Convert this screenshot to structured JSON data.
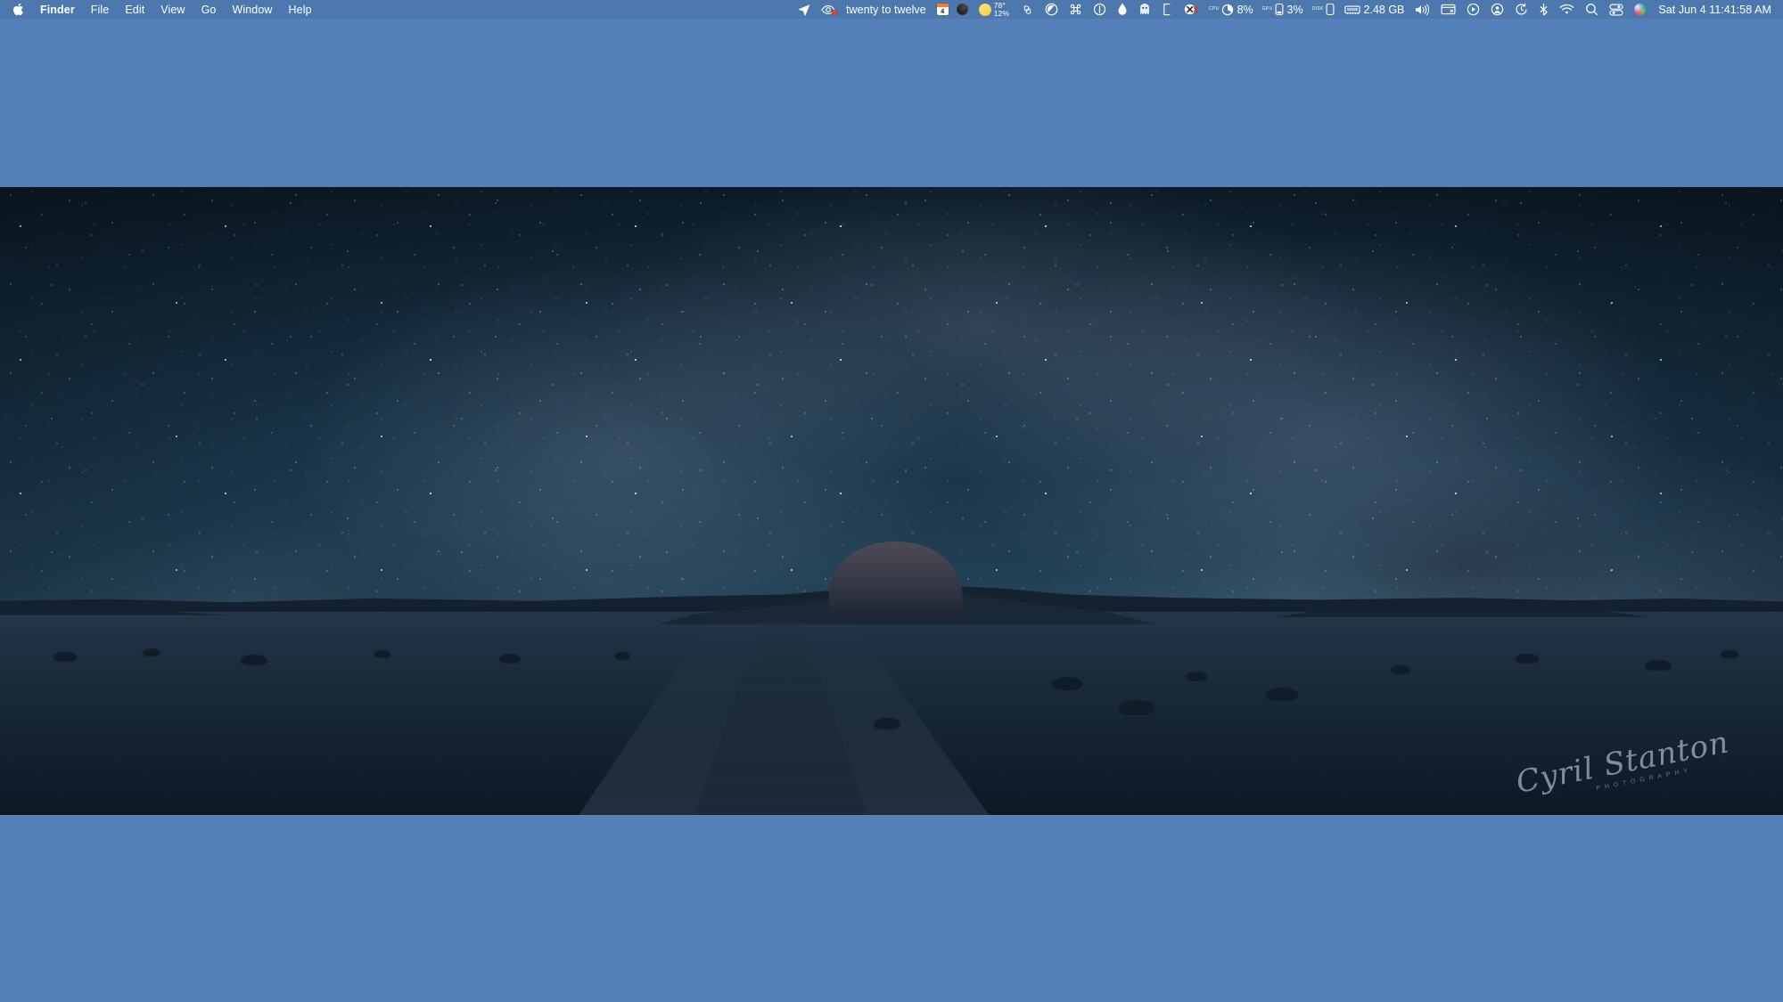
{
  "menubar": {
    "apple_icon": "apple-logo-icon",
    "app_menus": [
      {
        "label": "Finder",
        "bold": true
      },
      {
        "label": "File",
        "bold": false
      },
      {
        "label": "Edit",
        "bold": false
      },
      {
        "label": "View",
        "bold": false
      },
      {
        "label": "Go",
        "bold": false
      },
      {
        "label": "Window",
        "bold": false
      },
      {
        "label": "Help",
        "bold": false
      }
    ],
    "status": {
      "location_icon": "location-arrow-icon",
      "eye_globe_icon": "eye-globe-icon",
      "eye_globe_badge": true,
      "fuzzy_clock": "twenty to twelve",
      "calendar_day": "4",
      "moon_icon": "moon-phase-icon",
      "weather_icon": "sun-icon",
      "weather_temp": "78°",
      "weather_precip": "12%",
      "knot_icon": "knot-swirl-icon",
      "crescent_c_icon": "crescent-c-icon",
      "command_icon": "command-key-icon",
      "power_circle_icon": "power-circle-icon",
      "droplet_icon": "water-droplet-icon",
      "ghost_icon": "ghost-icon",
      "bracket_icon": "bracket-icon",
      "mouse_mute_icon": "mouse-mute-icon",
      "cpu_label": "CPU",
      "cpu_value": "8%",
      "gpu_label": "GPU",
      "gpu_value": "3%",
      "disk_label": "DISK",
      "memory_icon": "memory-chip-icon",
      "memory_value": "2.48 GB",
      "volume_icon": "volume-speaker-icon",
      "display_icon": "display-window-icon",
      "play_icon": "play-circle-icon",
      "user_icon": "user-circle-icon",
      "timemachine_icon": "time-machine-icon",
      "bluetooth_icon": "bluetooth-icon",
      "wifi_icon": "wifi-icon",
      "spotlight_icon": "spotlight-search-icon",
      "controlcenter_icon": "control-center-icon",
      "siri_icon": "siri-orb-icon",
      "clock": "Sat Jun 4  11:41:58 AM"
    }
  },
  "desktop": {
    "background_color": "#5481b8",
    "wallpaper": {
      "name": "milky-way-desert-panorama",
      "watermark_signature": "Cyril Stanton",
      "watermark_subtitle": "PHOTOGRAPHY"
    }
  }
}
